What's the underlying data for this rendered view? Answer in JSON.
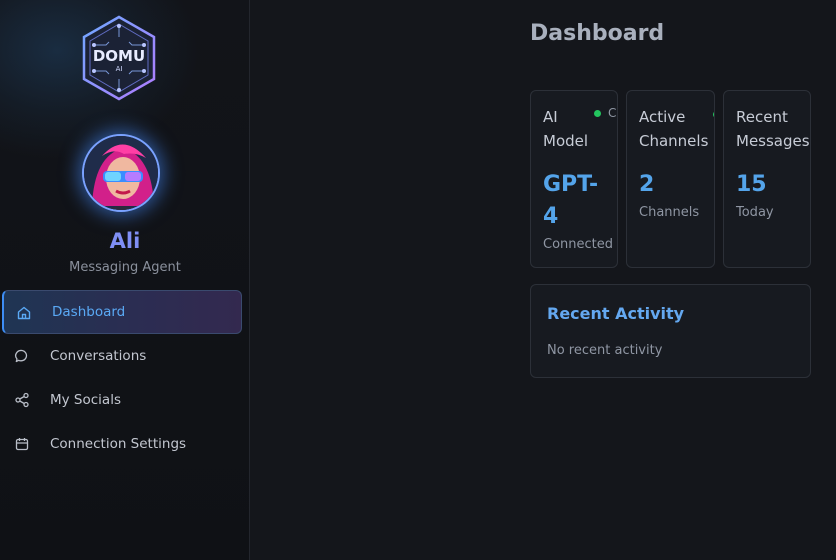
{
  "brand": {
    "logo_text": "DOMU",
    "logo_subtext": "AI"
  },
  "user": {
    "name": "Ali",
    "role": "Messaging Agent"
  },
  "sidebar": {
    "items": [
      {
        "label": "Dashboard",
        "icon": "home-icon",
        "active": true
      },
      {
        "label": "Conversations",
        "icon": "chat-bubble-icon",
        "active": false
      },
      {
        "label": "My Socials",
        "icon": "share-icon",
        "active": false
      },
      {
        "label": "Connection Settings",
        "icon": "calendar-icon",
        "active": false
      }
    ]
  },
  "main": {
    "title": "Dashboard",
    "stats": [
      {
        "label_line1": "AI",
        "label_line2": "Model",
        "value_line1": "GPT-",
        "value_line2": "4",
        "sub": "Connected",
        "status_text": "C"
      },
      {
        "label_line1": "Active",
        "label_line2": "Channels",
        "value": "2",
        "sub": "Channels"
      },
      {
        "label_line1": "Recent",
        "label_line2": "Messages",
        "value": "15",
        "sub": "Today"
      }
    ],
    "activity": {
      "title": "Recent Activity",
      "empty_text": "No recent activity"
    }
  },
  "colors": {
    "accent_blue": "#54a4ea",
    "name_purple": "#7f8ff5",
    "status_green": "#23c55e",
    "background": "#14161b"
  }
}
